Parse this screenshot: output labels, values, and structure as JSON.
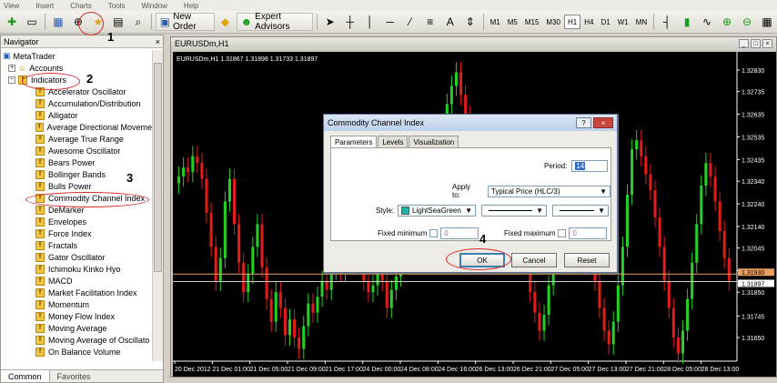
{
  "menu": [
    "View",
    "Insert",
    "Charts",
    "Tools",
    "Window",
    "Help"
  ],
  "toolbar": {
    "new_order_label": "New Order",
    "expert_advisors_label": "Expert Advisors",
    "timeframes": [
      "M1",
      "M5",
      "M15",
      "M30",
      "H1",
      "H4",
      "D1",
      "W1",
      "MN"
    ],
    "active_timeframe": "H1"
  },
  "navigator": {
    "title": "Navigator",
    "root": "MetaTrader",
    "accounts": "Accounts",
    "indicators": "Indicators",
    "items": [
      "Accelerator Oscillator",
      "Accumulation/Distribution",
      "Alligator",
      "Average Directional Moveme",
      "Average True Range",
      "Awesome Oscillator",
      "Bears Power",
      "Bollinger Bands",
      "Bulls Power",
      "Commodity Channel Index",
      "DeMarker",
      "Envelopes",
      "Force Index",
      "Fractals",
      "Gator Oscillator",
      "Ichimoku Kinko Hyo",
      "MACD",
      "Market Facilitation Index",
      "Momentum",
      "Money Flow Index",
      "Moving Average",
      "Moving Average of Oscillato",
      "On Balance Volume"
    ],
    "tabs": [
      "Common",
      "Favorites"
    ]
  },
  "chart": {
    "window_title": "EURUSDm,H1",
    "info": "EURUSDm,H1  1.31867 1.31898 1.31733 1.31897",
    "price_labels": [
      "1.32830",
      "1.32735",
      "1.32635",
      "1.32535",
      "1.32435",
      "1.32340",
      "1.32240",
      "1.32140",
      "1.32045",
      "1.31945",
      "1.31850",
      "1.31745",
      "1.31650"
    ],
    "bid_label": "1.31930",
    "ask_label": "1.31897",
    "time_labels": [
      "20 Dec 2012",
      "21 Dec 01:00",
      "21 Dec 05:00",
      "21 Dec 09:00",
      "21 Dec 17:00",
      "24 Dec 00:00",
      "24 Dec 08:00",
      "24 Dec 16:00",
      "26 Dec 13:00",
      "26 Dec 21:00",
      "27 Dec 05:00",
      "27 Dec 13:00",
      "27 Dec 21:00",
      "28 Dec 05:00",
      "28 Dec 13:00"
    ],
    "colors": {
      "bull": "#22d122",
      "bear": "#e21b1b",
      "bg": "#000000",
      "bidline": "#e8a060"
    }
  },
  "dialog": {
    "title": "Commodity Channel Index",
    "help": "?",
    "tabs": [
      "Parameters",
      "Levels",
      "Visualization"
    ],
    "period_label": "Period:",
    "period_value": "14",
    "apply_label": "Apply to:",
    "apply_value": "Typical Price (HLC/3)",
    "style_label": "Style:",
    "style_color": "LightSeaGreen",
    "fixed_min_label": "Fixed minimum",
    "fixed_min_value": "0",
    "fixed_max_label": "Fixed maximum",
    "fixed_max_value": "0",
    "ok": "OK",
    "cancel": "Cancel",
    "reset": "Reset"
  },
  "annotations": [
    "1",
    "2",
    "3",
    "4"
  ]
}
